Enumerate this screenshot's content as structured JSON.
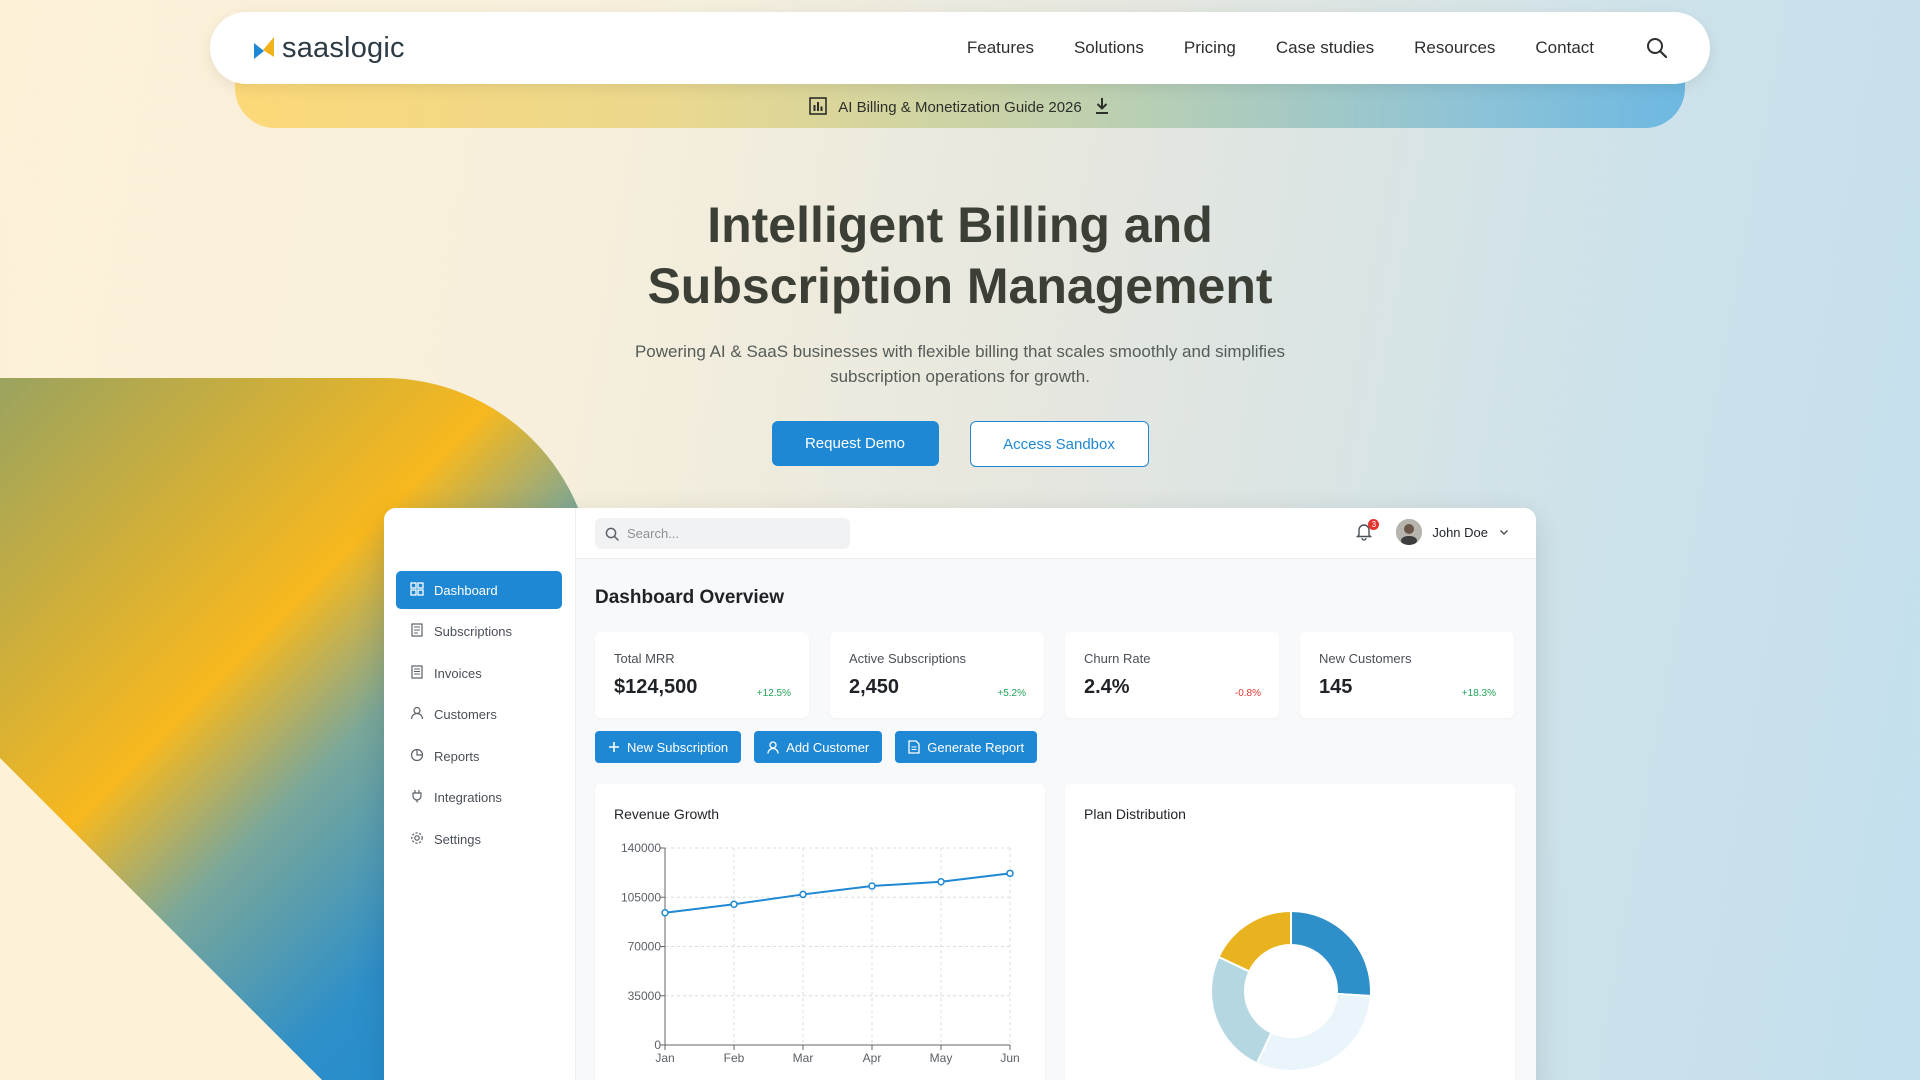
{
  "nav": {
    "logo_text": "saaslogic",
    "links": [
      "Features",
      "Solutions",
      "Pricing",
      "Case studies",
      "Resources",
      "Contact"
    ]
  },
  "banner": {
    "text": "AI Billing & Monetization Guide 2026"
  },
  "hero": {
    "title": "Intelligent Billing and Subscription Management",
    "subtitle": "Powering AI & SaaS businesses with flexible billing that scales smoothly and simplifies subscription operations for growth.",
    "primary_cta": "Request Demo",
    "secondary_cta": "Access Sandbox"
  },
  "app": {
    "search_placeholder": "Search...",
    "notification_count": "3",
    "user_name": "John Doe",
    "sidebar": [
      {
        "label": "Dashboard",
        "icon": "grid-icon",
        "active": true
      },
      {
        "label": "Subscriptions",
        "icon": "document-icon"
      },
      {
        "label": "Invoices",
        "icon": "invoice-icon"
      },
      {
        "label": "Customers",
        "icon": "user-icon"
      },
      {
        "label": "Reports",
        "icon": "pie-icon"
      },
      {
        "label": "Integrations",
        "icon": "plug-icon"
      },
      {
        "label": "Settings",
        "icon": "gear-icon"
      }
    ],
    "title": "Dashboard Overview",
    "stats": [
      {
        "label": "Total MRR",
        "value": "$124,500",
        "delta": "+12.5%",
        "trend": "up"
      },
      {
        "label": "Active Subscriptions",
        "value": "2,450",
        "delta": "+5.2%",
        "trend": "up"
      },
      {
        "label": "Churn Rate",
        "value": "2.4%",
        "delta": "-0.8%",
        "trend": "down"
      },
      {
        "label": "New Customers",
        "value": "145",
        "delta": "+18.3%",
        "trend": "up"
      }
    ],
    "actions": [
      "New Subscription",
      "Add Customer",
      "Generate Report"
    ],
    "revenue_card_title": "Revenue Growth",
    "plan_card_title": "Plan Distribution"
  },
  "colors": {
    "accent": "#1e88d4",
    "positive": "#22a35a",
    "negative": "#e3342f"
  },
  "chart_data": [
    {
      "type": "line",
      "title": "Revenue Growth",
      "categories": [
        "Jan",
        "Feb",
        "Mar",
        "Apr",
        "May",
        "Jun"
      ],
      "series": [
        {
          "values": [
            94000,
            100000,
            107000,
            113000,
            116000,
            122000
          ]
        }
      ],
      "ylim": [
        0,
        140000
      ],
      "yticks": [
        0,
        35000,
        70000,
        105000,
        140000
      ],
      "grid": true,
      "color": "#1e88d4"
    },
    {
      "type": "pie",
      "title": "Plan Distribution",
      "donut": true,
      "values": [
        26,
        31,
        25,
        18
      ],
      "colors": [
        "#2e8fc9",
        "#eaf4fb",
        "#b5d7e1",
        "#e8b31f"
      ]
    }
  ]
}
